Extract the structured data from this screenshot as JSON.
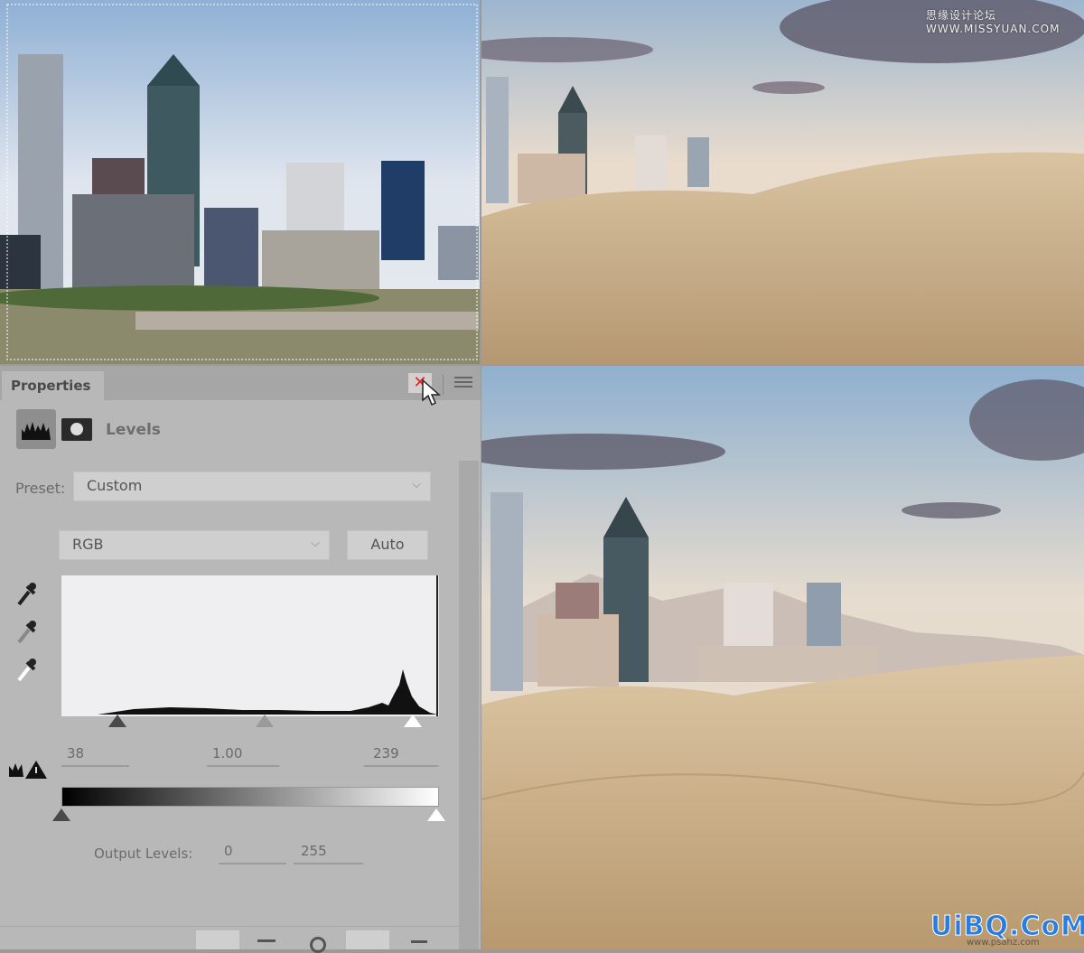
{
  "panel": {
    "tab_title": "Properties",
    "close_icon": "close-icon",
    "menu_icon": "panel-menu-icon",
    "adjustment_icon": "levels-histogram-icon",
    "mask_icon": "layer-mask-icon",
    "adjustment_name": "Levels",
    "preset_label": "Preset:",
    "preset_value": "Custom",
    "channel_value": "RGB",
    "auto_label": "Auto",
    "eyedroppers": [
      "black-point-eyedropper-icon",
      "gray-point-eyedropper-icon",
      "white-point-eyedropper-icon"
    ],
    "input_levels": {
      "black": "38",
      "gamma": "1.00",
      "white": "239"
    },
    "output_label": "Output Levels:",
    "output_levels": {
      "black": "0",
      "white": "255"
    },
    "close_button_color": "#e02020"
  },
  "watermarks": {
    "top": "思缘设计论坛  WWW.MISSYUAN.COM",
    "bottom_logo": "UiBQ.CoM",
    "bottom_sub": "www.psahz.com"
  }
}
